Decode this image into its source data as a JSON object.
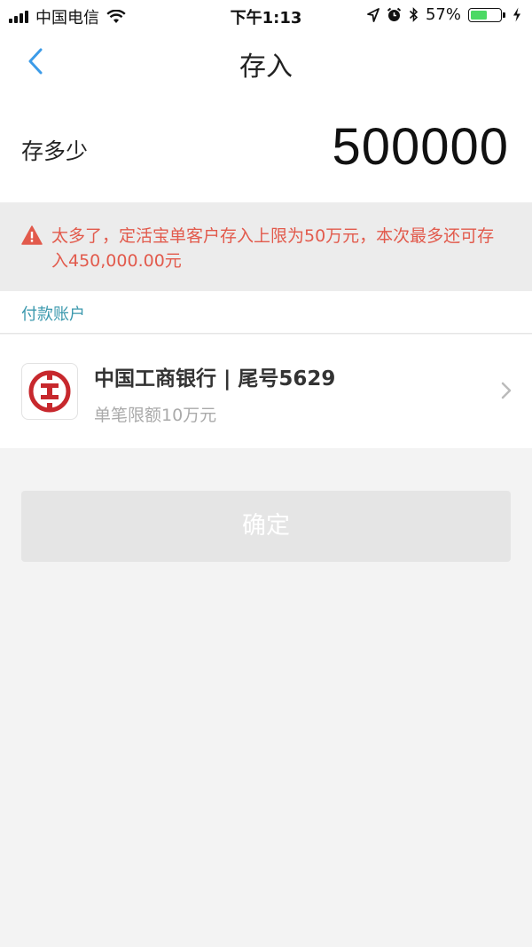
{
  "status_bar": {
    "carrier": "中国电信",
    "time": "下午1:13",
    "battery_percent": "57%",
    "battery_level": 0.57,
    "icons": [
      "signal-icon",
      "wifi-icon",
      "location-icon",
      "alarm-icon",
      "bluetooth-icon",
      "battery-icon",
      "charging-icon"
    ]
  },
  "nav": {
    "title": "存入",
    "back_icon": "chevron-left-icon"
  },
  "amount": {
    "label": "存多少",
    "value": "500000"
  },
  "warning": {
    "icon": "warning-triangle-icon",
    "text": "太多了，定活宝单客户存入上限为50万元，本次最多还可存入450,000.00元"
  },
  "payment": {
    "section_label": "付款账户",
    "bank_name": "中国工商银行 | 尾号5629",
    "limit": "单笔限额10万元",
    "logo_icon": "icbc-logo-icon",
    "chevron_icon": "chevron-right-icon"
  },
  "confirm": {
    "label": "确定"
  },
  "colors": {
    "accent_blue": "#3a98ad",
    "back_blue": "#3c9be8",
    "warning_red": "#e25a4c",
    "icbc_red": "#c7282d",
    "battery_green": "#4cd964",
    "disabled_button": "#e5e5e5"
  }
}
